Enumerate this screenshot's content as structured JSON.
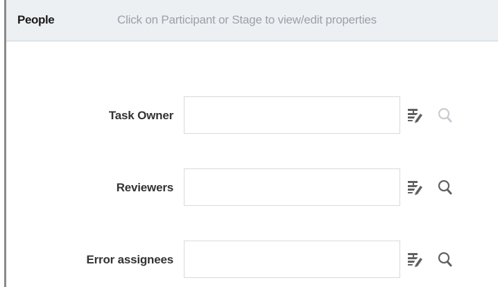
{
  "header": {
    "title": "People",
    "hint": "Click on Participant or Stage to view/edit properties"
  },
  "fields": [
    {
      "label": "Task Owner",
      "value": "",
      "search_enabled": false
    },
    {
      "label": "Reviewers",
      "value": "",
      "search_enabled": true
    },
    {
      "label": "Error assignees",
      "value": "",
      "search_enabled": true
    }
  ],
  "icons": {
    "edit": "edit-list-icon",
    "search": "search-icon"
  },
  "colors": {
    "header_bg": "#edf0f3",
    "icon_active": "#606060",
    "icon_disabled": "#c8ccd0",
    "label": "#333333",
    "hint": "#9aa1a8"
  }
}
